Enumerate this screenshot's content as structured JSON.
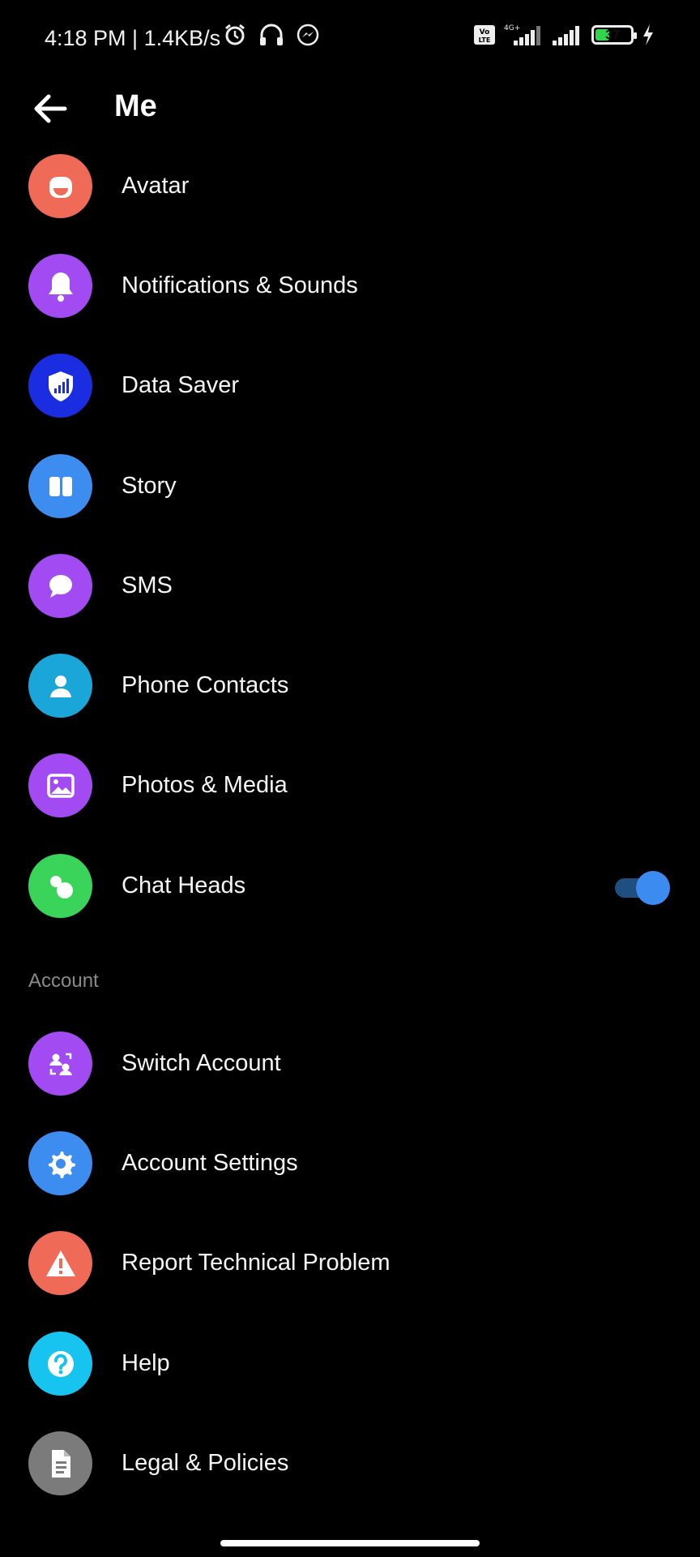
{
  "status_bar": {
    "time": "4:18 PM | 1.4KB/s",
    "battery_level": "37",
    "battery_level_fraction": 0.37,
    "network_label": "4G+",
    "volte_label": "Vo LTE"
  },
  "app_bar": {
    "title": "Me"
  },
  "menu": {
    "items": [
      {
        "label": "Avatar",
        "icon": "avatar-icon",
        "color": "#f06b57"
      },
      {
        "label": "Notifications & Sounds",
        "icon": "bell-icon",
        "color": "#a24bf2"
      },
      {
        "label": "Data Saver",
        "icon": "shield-signal-icon",
        "color": "#1b2de0"
      },
      {
        "label": "Story",
        "icon": "story-icon",
        "color": "#3d8df0"
      },
      {
        "label": "SMS",
        "icon": "chat-bubble-icon",
        "color": "#a24bf2"
      },
      {
        "label": "Phone Contacts",
        "icon": "phone-contacts-icon",
        "color": "#1aa6d8"
      },
      {
        "label": "Photos & Media",
        "icon": "photo-icon",
        "color": "#a24bf2"
      },
      {
        "label": "Chat Heads",
        "icon": "chat-heads-icon",
        "color": "#3ad45a",
        "toggle_on": true
      }
    ]
  },
  "account_section": {
    "header": "Account",
    "items": [
      {
        "label": "Switch Account",
        "icon": "switch-account-icon",
        "color": "#a24bf2"
      },
      {
        "label": "Account Settings",
        "icon": "gear-icon",
        "color": "#3d8df0"
      },
      {
        "label": "Report Technical Problem",
        "icon": "warning-icon",
        "color": "#f06b57"
      },
      {
        "label": "Help",
        "icon": "help-icon",
        "color": "#17c3ef"
      },
      {
        "label": "Legal & Policies",
        "icon": "document-icon",
        "color": "#7b7b7b"
      }
    ]
  },
  "colors": {
    "background": "#000000",
    "toggle_accent": "#3b8bf0"
  }
}
